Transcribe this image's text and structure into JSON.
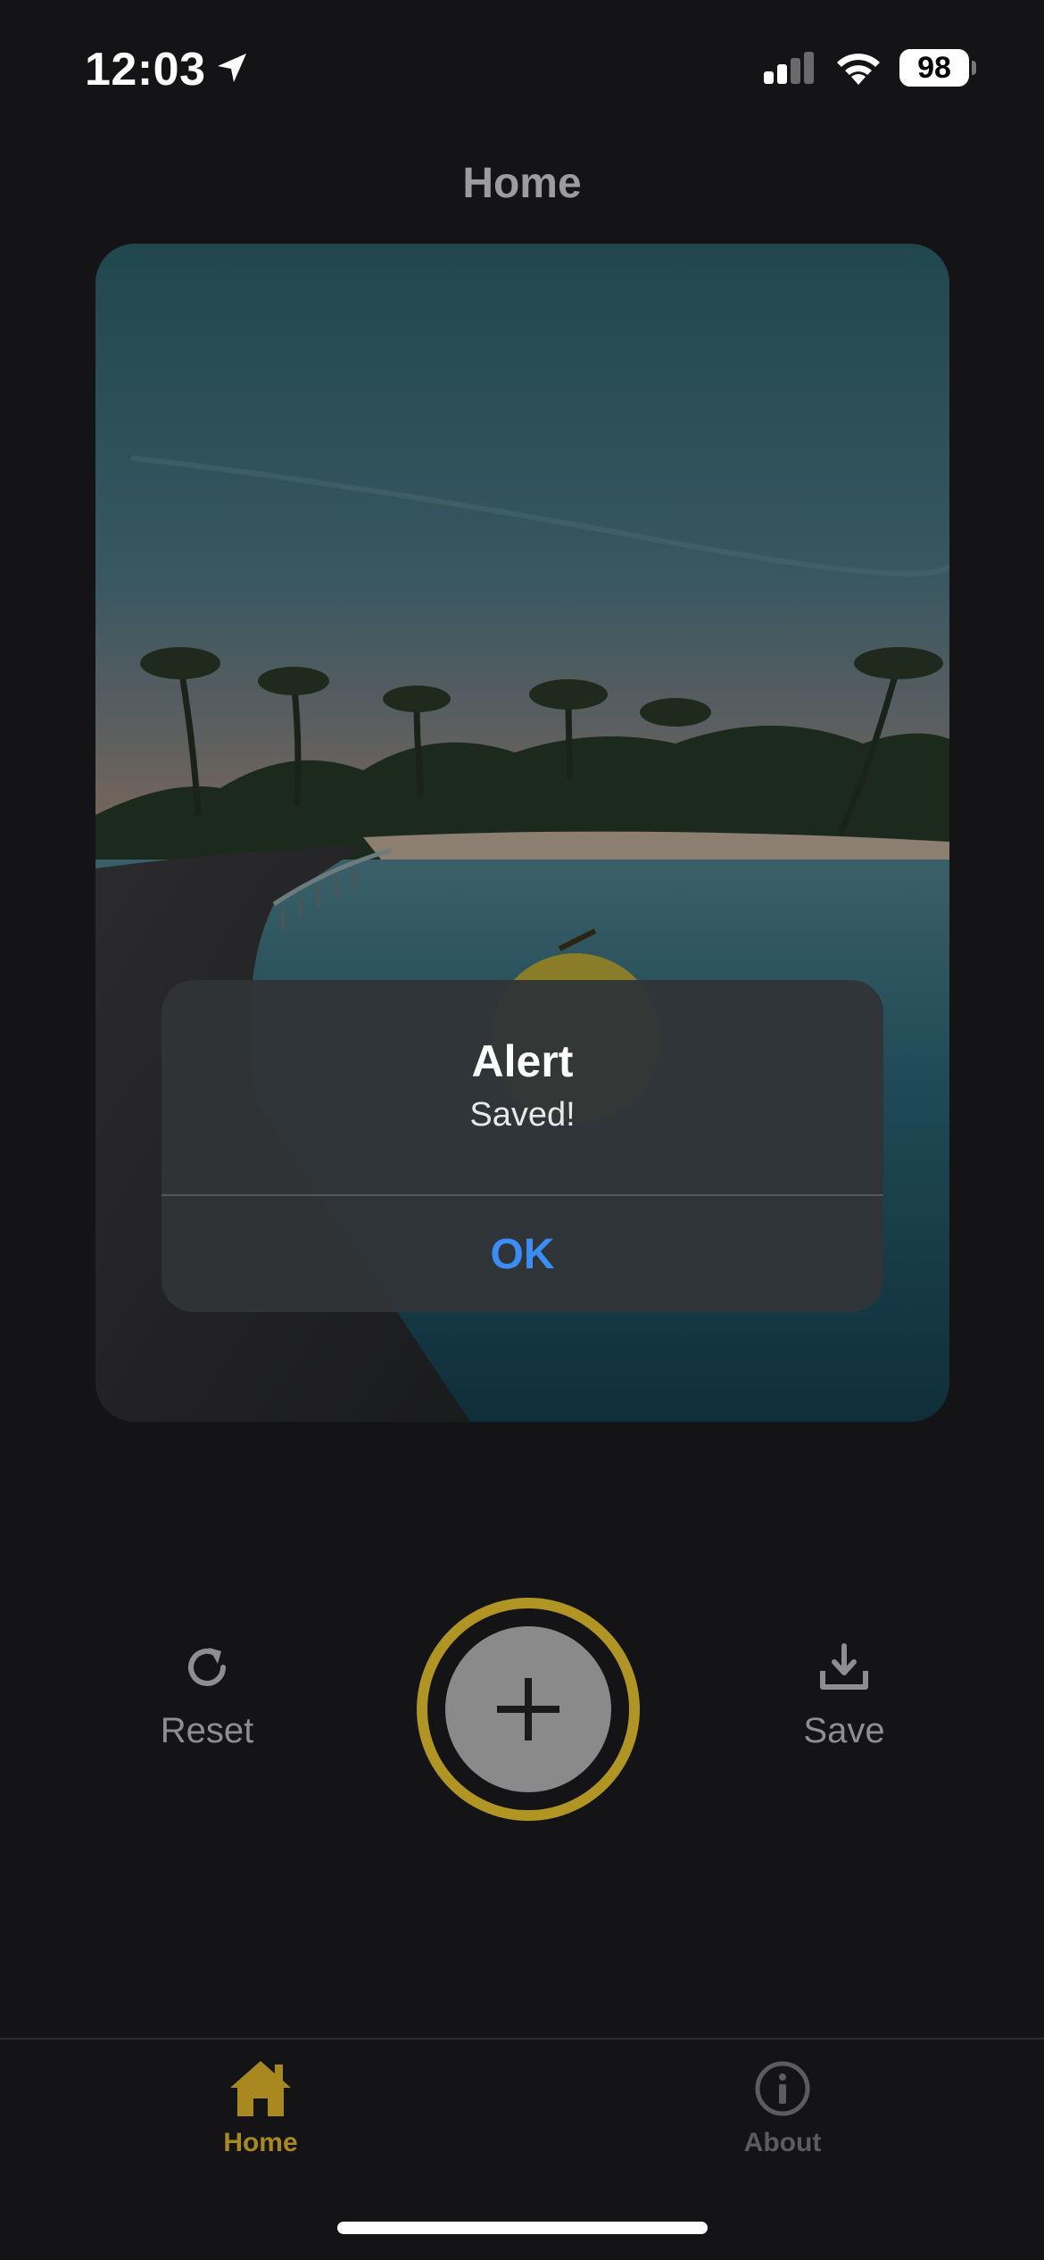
{
  "status_bar": {
    "time": "12:03",
    "battery": "98",
    "icons": [
      "location-arrow-icon",
      "cellular-signal-icon",
      "wifi-icon",
      "battery-icon"
    ]
  },
  "nav": {
    "title": "Home"
  },
  "photo": {
    "description_icon": "photo-image"
  },
  "alert": {
    "title": "Alert",
    "message": "Saved!",
    "ok_label": "OK"
  },
  "actions": {
    "reset_label": "Reset",
    "save_label": "Save",
    "reset_icon": "refresh-icon",
    "save_icon": "download-icon",
    "add_icon": "plus-icon"
  },
  "tabs": [
    {
      "label": "Home",
      "icon": "house-icon",
      "active": true
    },
    {
      "label": "About",
      "icon": "info-icon",
      "active": false
    }
  ],
  "colors": {
    "background": "#141417",
    "accent_gold": "#b19524",
    "tab_active": "#a9891f",
    "tab_inactive": "#5b5b60",
    "alert_button": "#3b8cf3"
  }
}
